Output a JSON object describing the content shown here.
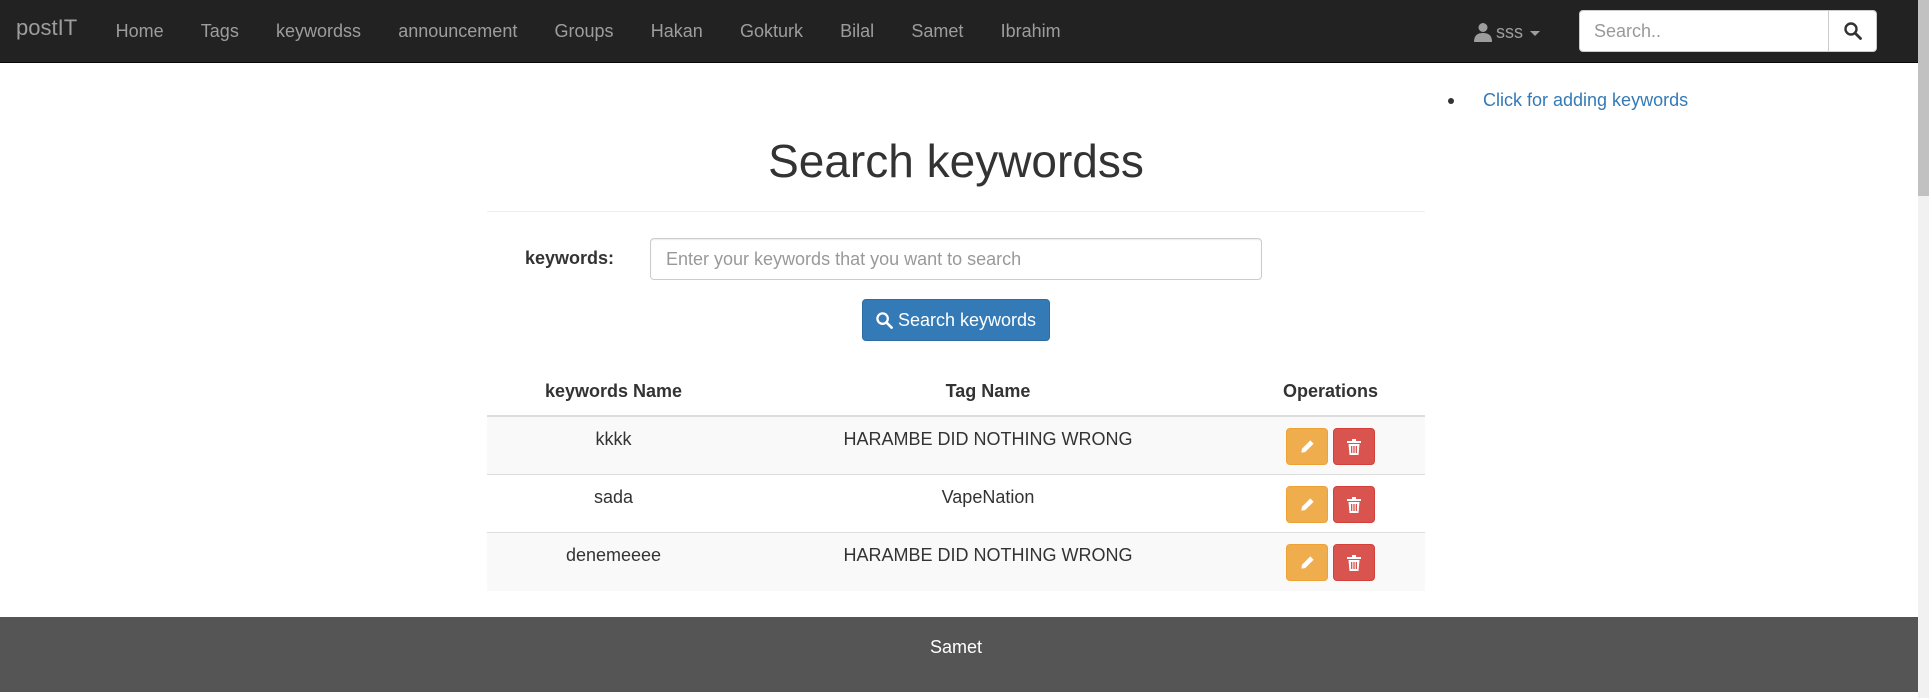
{
  "navbar": {
    "brand": "postIT",
    "links": [
      "Home",
      "Tags",
      "keywordss",
      "announcement",
      "Groups",
      "Hakan",
      "Gokturk",
      "Bilal",
      "Samet",
      "Ibrahim"
    ],
    "user": "sss",
    "search_placeholder": "Search.."
  },
  "sidebar": {
    "link": "Click for adding keywords"
  },
  "main": {
    "title": "Search keywordss",
    "form": {
      "label": "keywords:",
      "placeholder": "Enter your keywords that you want to search",
      "button": "Search keywords"
    },
    "table": {
      "headers": [
        "keywords Name",
        "Tag Name",
        "Operations"
      ],
      "rows": [
        {
          "keyword": "kkkk",
          "tag": "HARAMBE DID NOTHING WRONG"
        },
        {
          "keyword": "sada",
          "tag": "VapeNation"
        },
        {
          "keyword": "denemeeee",
          "tag": "HARAMBE DID NOTHING WRONG"
        }
      ]
    }
  },
  "footer": {
    "text": "Samet"
  },
  "colors": {
    "navbar_bg": "#222222",
    "primary": "#337ab7",
    "warning": "#f0ad4e",
    "danger": "#d9534f",
    "footer_bg": "#555555"
  },
  "icons": {
    "user": "user-icon",
    "search": "search-icon",
    "edit": "pencil-icon",
    "delete": "trash-icon"
  }
}
